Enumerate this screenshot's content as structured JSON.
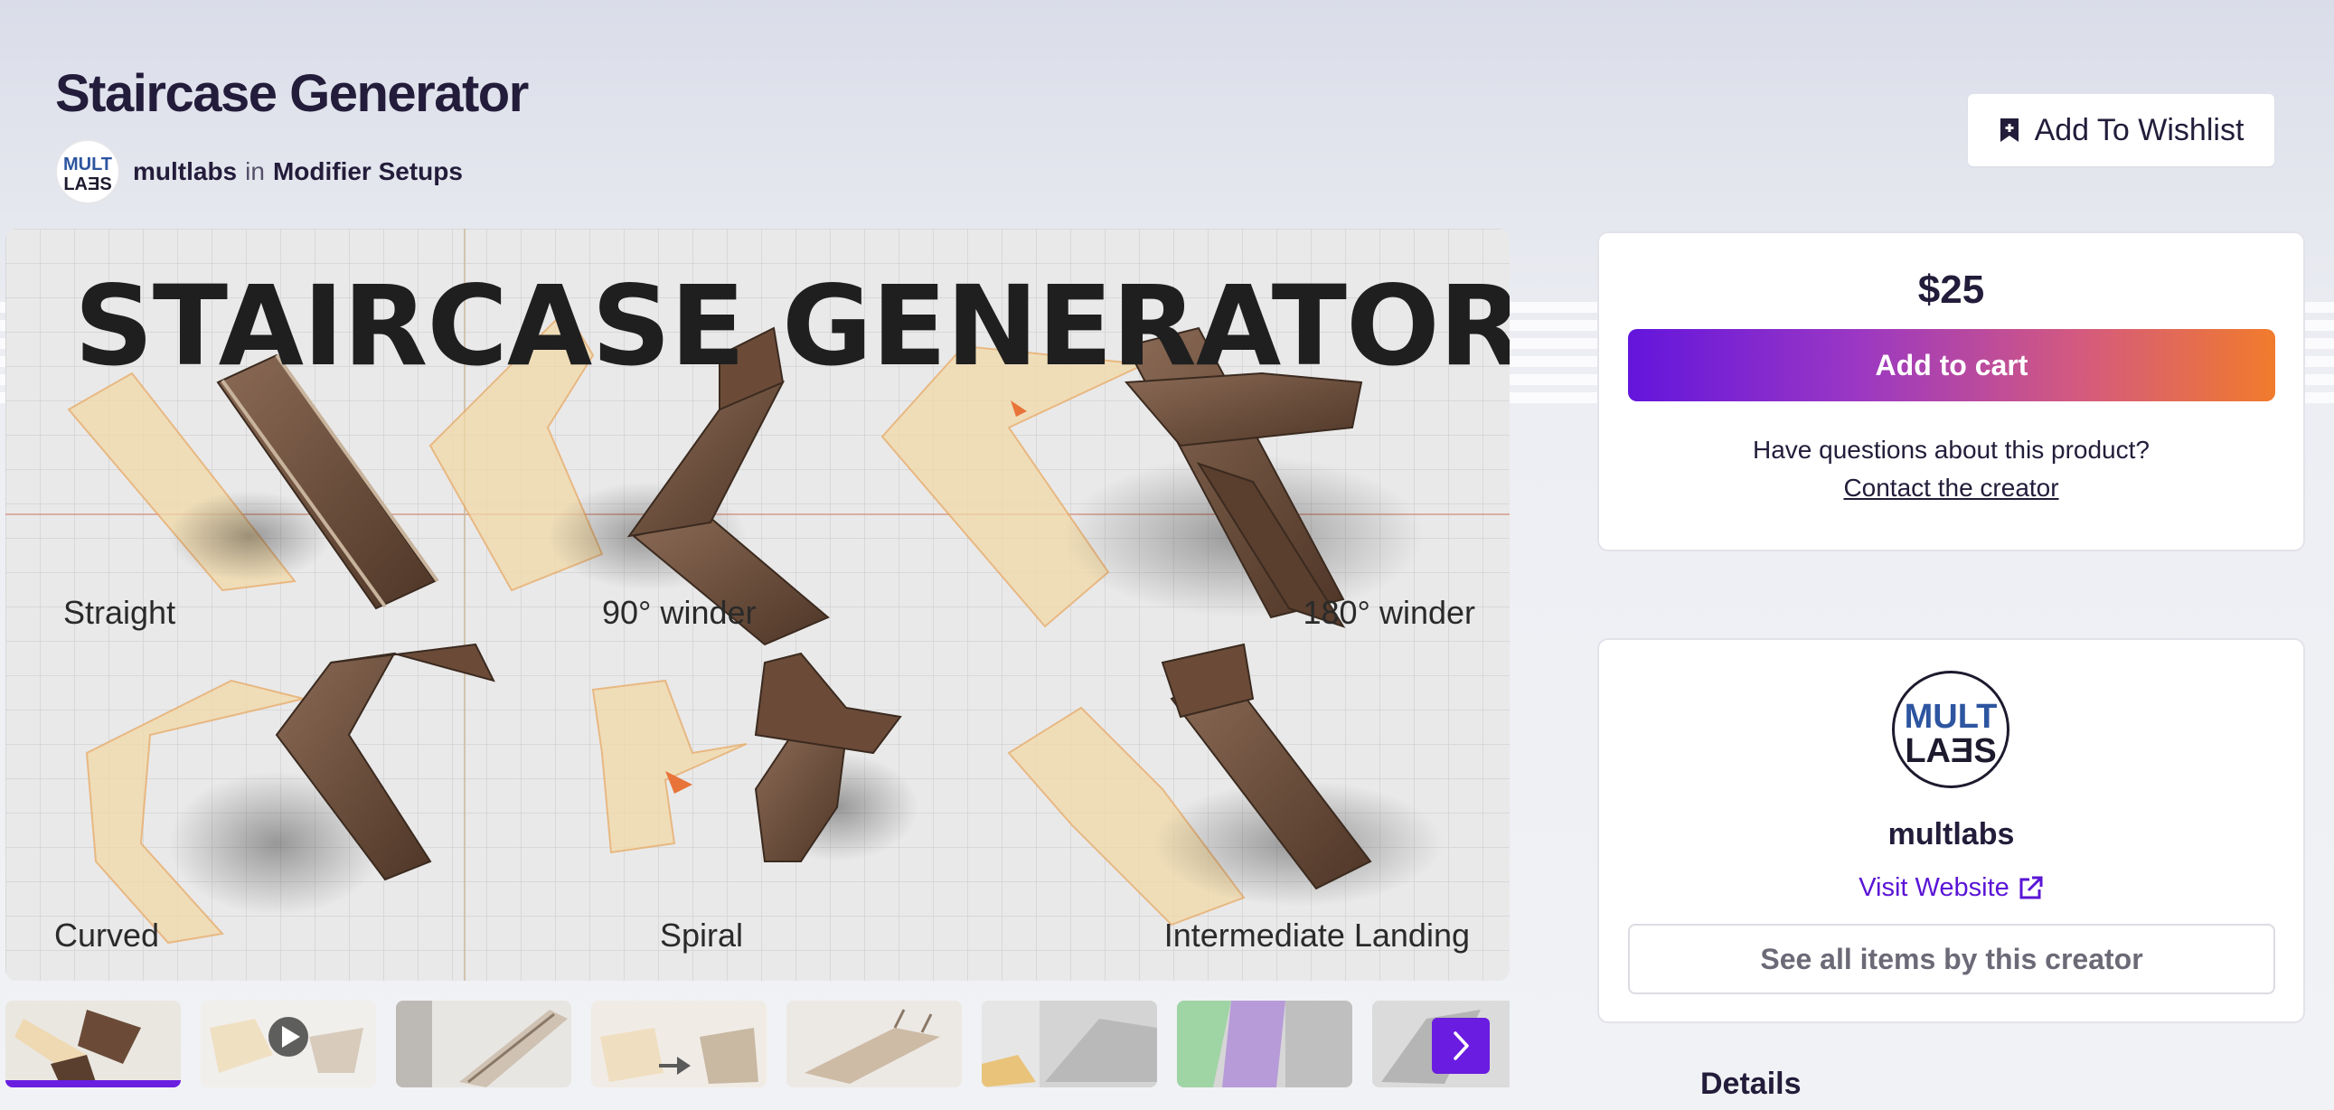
{
  "product": {
    "title": "Staircase Generator",
    "creator": "multlabs",
    "in_word": "in",
    "category": "Modifier Setups",
    "wishlist_label": "Add To Wishlist"
  },
  "gallery": {
    "main_heading": "STAIRCASE GENERATOR",
    "labels": {
      "straight": "Straight",
      "winder90": "90° winder",
      "winder180": "180° winder",
      "curved": "Curved",
      "spiral": "Spiral",
      "landing": "Intermediate Landing"
    },
    "thumbnail_count": 8,
    "active_thumbnail": 1
  },
  "purchase": {
    "price": "$25",
    "cart_label": "Add to cart",
    "question": "Have questions about this product?",
    "contact_label": "Contact the creator",
    "accent_gradient": [
      "#6315dc",
      "#f17b2c"
    ]
  },
  "creator_card": {
    "name": "multlabs",
    "logo_top": "MULT",
    "logo_bottom": "LAƎS",
    "visit_label": "Visit Website",
    "see_all_label": "See all items by this creator",
    "link_color": "#5a14d6"
  },
  "section": {
    "details_heading": "Details"
  },
  "icons": {
    "wishlist": "bookmark-plus-icon",
    "external": "external-link-icon",
    "next": "chevron-right-icon",
    "play": "play-icon"
  }
}
